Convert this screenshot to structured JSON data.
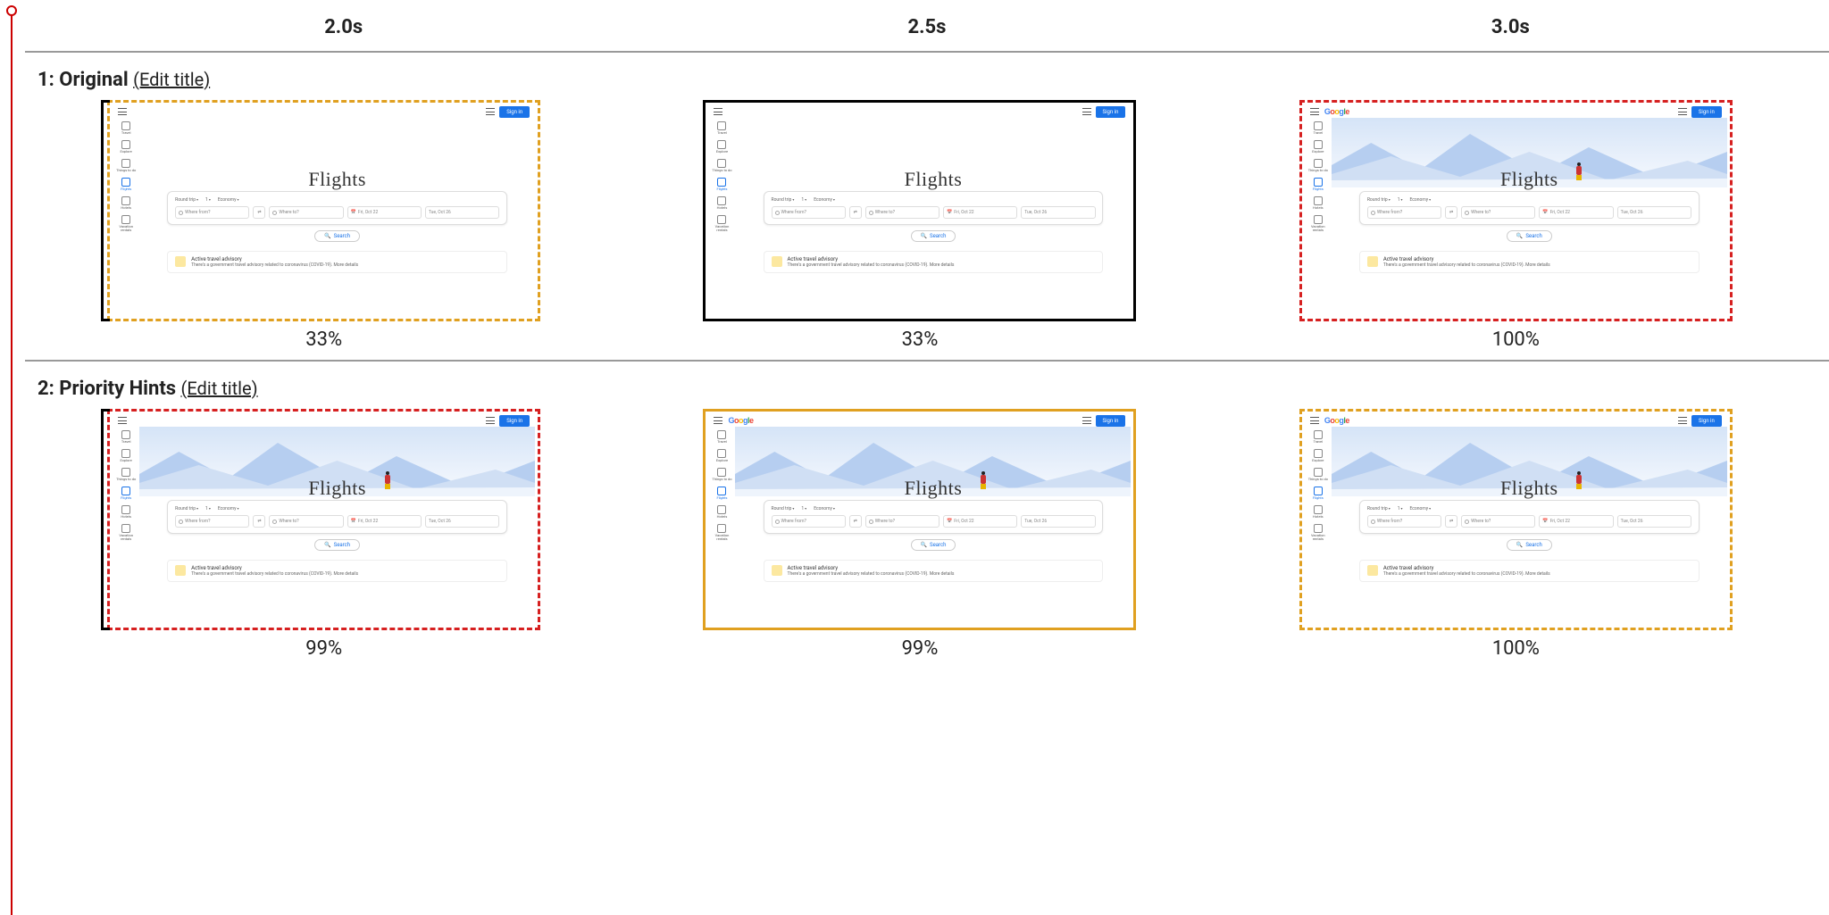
{
  "time_columns": [
    "2.0s",
    "2.5s",
    "3.0s"
  ],
  "rows": [
    {
      "id": 1,
      "label": "Original",
      "edit_label": "(Edit title)",
      "frames": [
        {
          "percent": "33%",
          "border": "dashed-orange",
          "show_hero": false,
          "show_logo": false,
          "lcp_bracket": true
        },
        {
          "percent": "33%",
          "border": "solid-black",
          "show_hero": false,
          "show_logo": false,
          "lcp_bracket": false
        },
        {
          "percent": "100%",
          "border": "dashed-red",
          "show_hero": true,
          "show_logo": true,
          "lcp_bracket": false
        }
      ]
    },
    {
      "id": 2,
      "label": "Priority Hints",
      "edit_label": "(Edit title)",
      "frames": [
        {
          "percent": "99%",
          "border": "dashed-red",
          "show_hero": true,
          "show_logo": false,
          "lcp_bracket": true
        },
        {
          "percent": "99%",
          "border": "solid-orange",
          "show_hero": true,
          "show_logo": true,
          "lcp_bracket": false
        },
        {
          "percent": "100%",
          "border": "dashed-orange",
          "show_hero": true,
          "show_logo": true,
          "lcp_bracket": false
        }
      ]
    }
  ],
  "mini_page": {
    "sign_in": "Sign in",
    "logo_chars": [
      "G",
      "o",
      "o",
      "g",
      "l",
      "e"
    ],
    "side_items": [
      "Travel",
      "Explore",
      "Things to do",
      "Flights",
      "Hotels",
      "Vacation rentals"
    ],
    "heading": "Flights",
    "chips": [
      "Round trip",
      "1",
      "Economy"
    ],
    "fields": {
      "from": "Where from?",
      "swap": "⇄",
      "to": "Where to?",
      "date1": "Fri, Oct 22",
      "date2": "Tue, Oct 26"
    },
    "search_label": "Search",
    "advisory": {
      "title": "Active travel advisory",
      "sub": "There's a government travel advisory related to coronavirus (COVID-19).",
      "link": "More details"
    }
  }
}
